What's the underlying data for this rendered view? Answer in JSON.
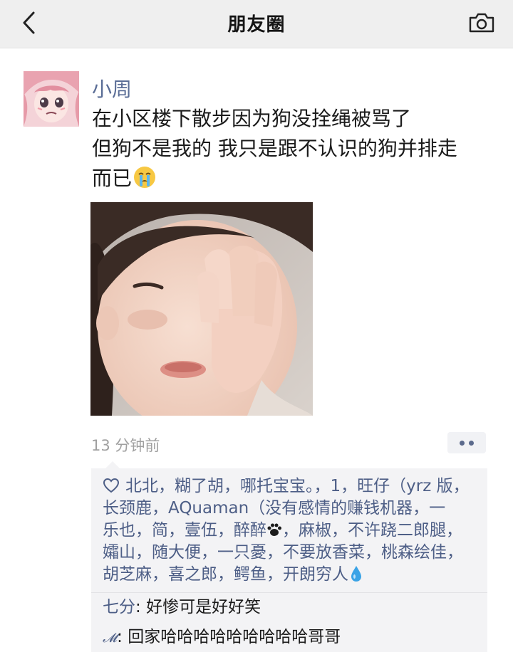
{
  "nav": {
    "title": "朋友圈",
    "back_icon": "chevron-left-icon",
    "camera_icon": "camera-icon"
  },
  "post": {
    "author": "小周",
    "text_lines": [
      "在小区楼下散步因为狗没拴绳被骂了",
      "但狗不是我的 我只是跟不认识的狗并排走",
      "而已"
    ],
    "text_emoji": "crying-face-emoji",
    "time": "13 分钟前"
  },
  "likes": {
    "icon": "heart-outline-icon",
    "lines": [
      "北北，糊了胡，哪托宝宝。，1，旺仔（yrz 版，",
      "长颈鹿，AQuaman（没有感情的赚钱机器，一",
      "乐也，简，壹伍，醉醉",
      "，麻椒，不许跷二郎腿，",
      "孀山，随大便，一只憂，不要放香菜，桃森绘佳，",
      "胡芝麻，喜之郎，鳄鱼，开朗穷人"
    ]
  },
  "comments": [
    {
      "name": "七分",
      "sep": ": ",
      "text": "好惨可是好好笑"
    },
    {
      "name": "𝓜",
      "sep": ": ",
      "text": "回家哈哈哈哈哈哈哈哈哈哥哥"
    }
  ],
  "colors": {
    "link": "#5a6d96",
    "time": "#a0a0a0",
    "panel": "#f3f3f5",
    "nav": "#efefef"
  }
}
